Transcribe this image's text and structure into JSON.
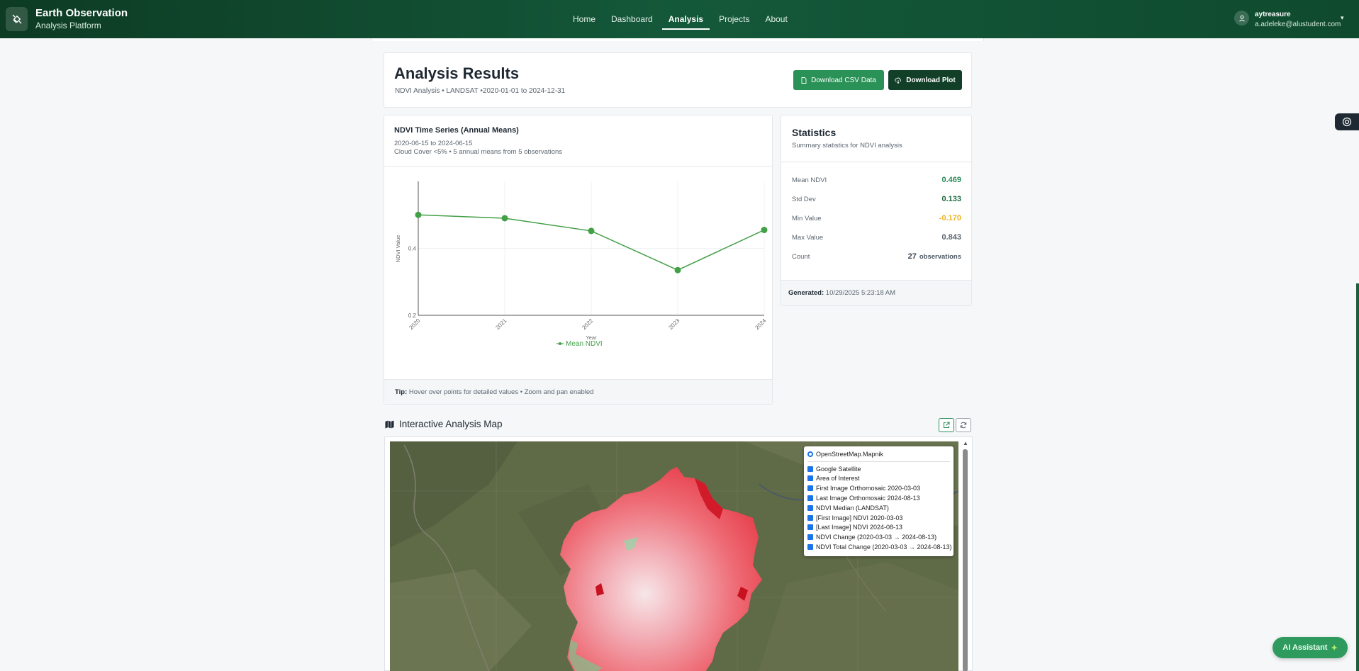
{
  "header": {
    "brand_title": "Earth Observation",
    "brand_subtitle": "Analysis Platform",
    "nav": [
      {
        "label": "Home",
        "active": false
      },
      {
        "label": "Dashboard",
        "active": false
      },
      {
        "label": "Analysis",
        "active": true
      },
      {
        "label": "Projects",
        "active": false
      },
      {
        "label": "About",
        "active": false
      }
    ],
    "user": {
      "name": "aytreasure",
      "email": "a.adeleke@alustudent.com"
    }
  },
  "results": {
    "title": "Analysis Results",
    "subtitle": "NDVI Analysis • LANDSAT •2020-01-01 to 2024-12-31",
    "download_csv_label": "Download CSV Data",
    "download_plot_label": "Download Plot"
  },
  "timeseries": {
    "title": "NDVI Time Series (Annual Means)",
    "range": "2020-06-15 to 2024-06-15",
    "meta": "Cloud Cover <5% • 5 annual means from 5 observations",
    "tip_label": "Tip:",
    "tip_text": " Hover over points for detailed values • Zoom and pan enabled"
  },
  "chart_data": {
    "type": "line",
    "x": [
      "2020",
      "2021",
      "2022",
      "2023",
      "2024"
    ],
    "series": [
      {
        "name": "Mean NDVI",
        "values": [
          0.5,
          0.49,
          0.452,
          0.335,
          0.455
        ],
        "color": "#43a047"
      }
    ],
    "xlabel": "Year",
    "ylabel": "NDVI Value",
    "yticks": [
      "0.2",
      "0.4"
    ],
    "ylim": [
      0.2,
      0.6
    ],
    "grid": true,
    "legend": "bottom-center"
  },
  "statistics": {
    "title": "Statistics",
    "subtitle": "Summary statistics for NDVI analysis",
    "rows": [
      {
        "label": "Mean NDVI",
        "value": "0.469",
        "color": "#2e8b57"
      },
      {
        "label": "Std Dev",
        "value": "0.133",
        "color": "#1c6b40"
      },
      {
        "label": "Min Value",
        "value": "-0.170",
        "color": "#f0b323"
      },
      {
        "label": "Max Value",
        "value": "0.843",
        "color": "#5b6570"
      },
      {
        "label": "Count",
        "value": "27",
        "unit": "observations",
        "color": "#3a4550"
      }
    ],
    "generated_label": "Generated:",
    "generated_value": " 10/29/2025 5:23:18 AM"
  },
  "map": {
    "title": "Interactive Analysis Map",
    "base_layer": "OpenStreetMap.Mapnik",
    "overlays": [
      "Google Satellite",
      "Area of Interest",
      "First Image Orthomosaic 2020-03-03",
      "Last Image Orthomosaic 2024-08-13",
      "NDVI Median (LANDSAT)",
      "[First Image] NDVI 2020-03-03",
      "[Last Image] NDVI 2024-08-13",
      "NDVI Change (2020-03-03 → 2024-08-13)",
      "NDVI Total Change (2020-03-03 → 2024-08-13)"
    ]
  },
  "assistant": {
    "label": "AI Assistant",
    "icon": "sparkle-icon"
  },
  "colors": {
    "brand": "#14583a",
    "accent": "#2a9157",
    "ndvi_line": "#43a047"
  }
}
